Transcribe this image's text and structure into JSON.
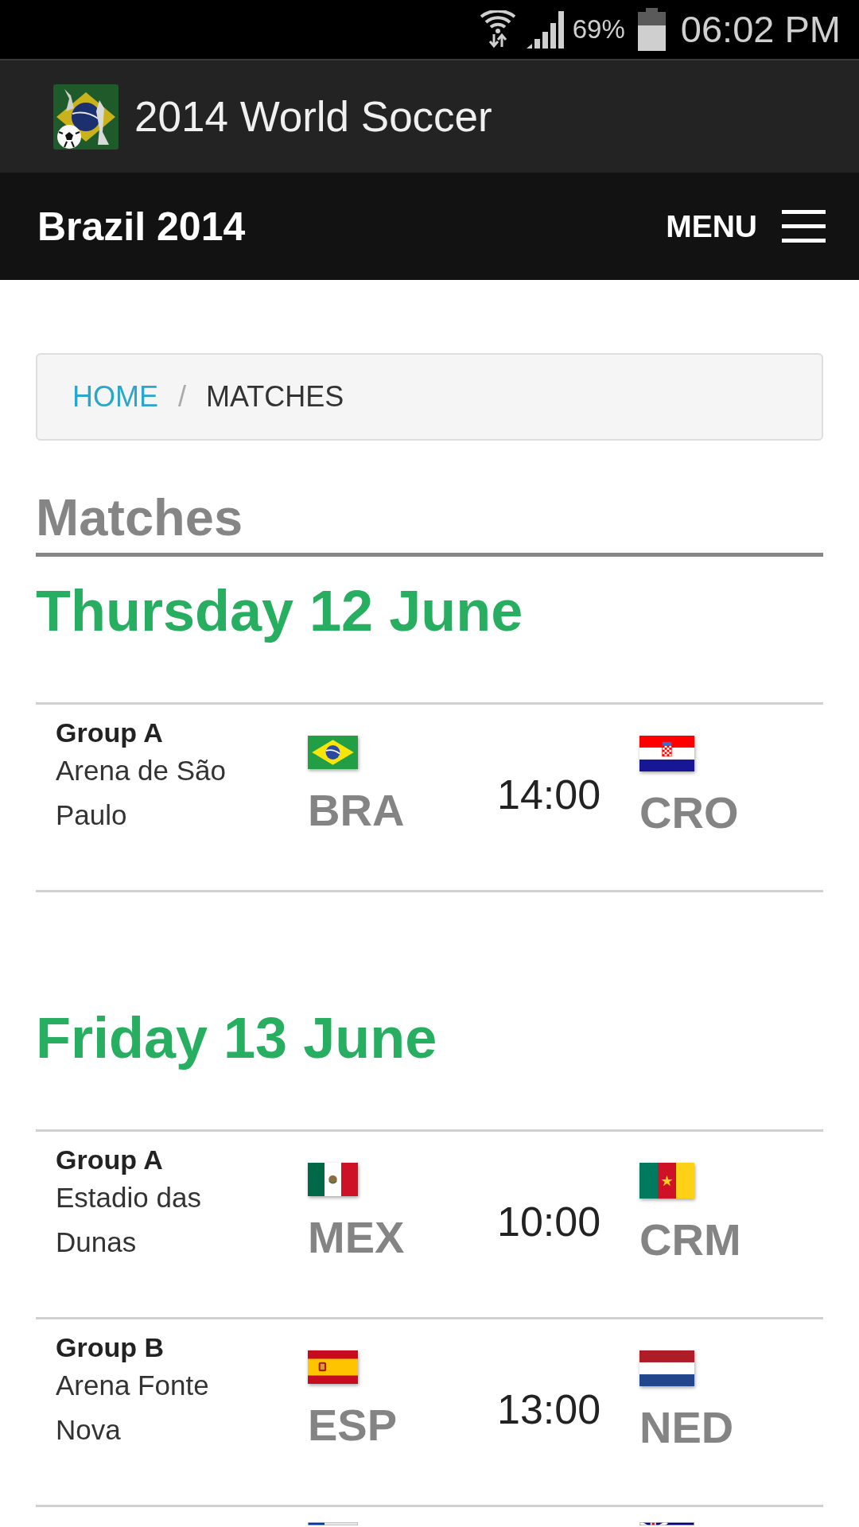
{
  "status_bar": {
    "battery": "69%",
    "time": "06:02 PM"
  },
  "app_bar": {
    "title": "2014 World Soccer"
  },
  "nav_bar": {
    "brand": "Brazil 2014",
    "menu_label": "MENU"
  },
  "breadcrumb": {
    "separator": "/",
    "items": [
      {
        "label": "HOME",
        "kind": "link"
      },
      {
        "label": "MATCHES",
        "kind": "current"
      }
    ]
  },
  "page_title": "Matches",
  "days": [
    {
      "heading": "Thursday 12 June",
      "matches": [
        {
          "group": "Group A",
          "venue": "Arena de São Paulo",
          "home": {
            "code": "BRA",
            "kind": "brazil"
          },
          "time": "14:00",
          "away": {
            "code": "CRO",
            "kind": "croatia"
          }
        }
      ]
    },
    {
      "heading": "Friday 13 June",
      "matches": [
        {
          "group": "Group A",
          "venue": "Estadio das Dunas",
          "home": {
            "code": "MEX",
            "kind": "mexico"
          },
          "time": "10:00",
          "away": {
            "code": "CRM",
            "kind": "cameroon"
          }
        },
        {
          "group": "Group B",
          "venue": "Arena Fonte Nova",
          "home": {
            "code": "ESP",
            "kind": "spain"
          },
          "time": "13:00",
          "away": {
            "code": "NED",
            "kind": "netherlands"
          }
        },
        {
          "home": {
            "kind": "chile"
          },
          "away": {
            "kind": "australia"
          }
        }
      ]
    }
  ]
}
